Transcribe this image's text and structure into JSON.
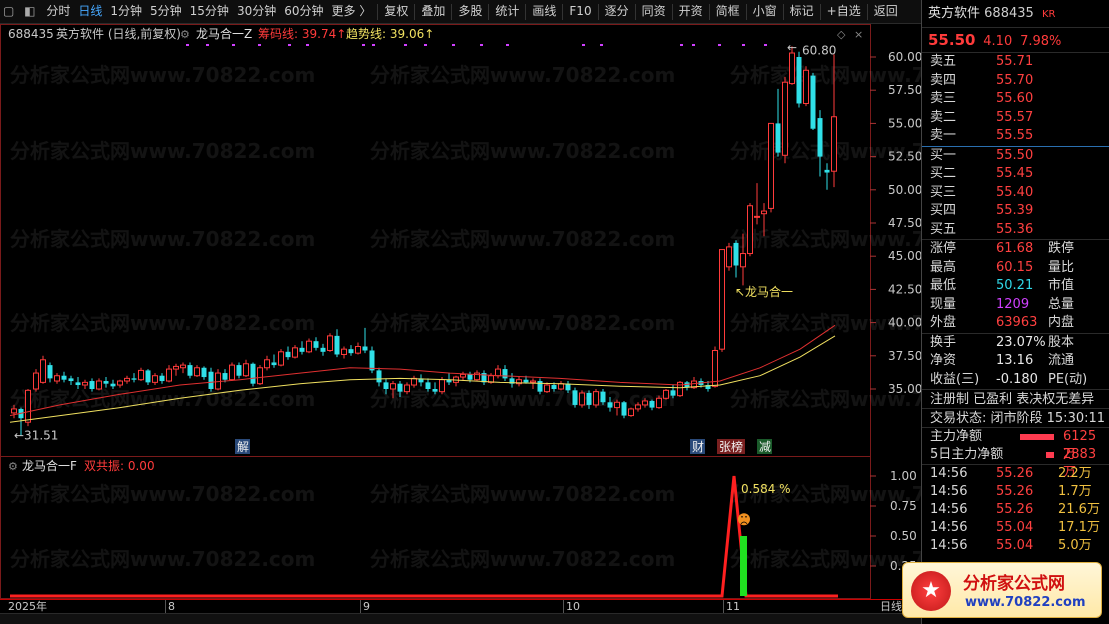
{
  "toolbar": {
    "items": [
      "分时",
      "日线",
      "1分钟",
      "5分钟",
      "15分钟",
      "30分钟",
      "60分钟",
      "更多 〉",
      "复权",
      "叠加",
      "多股",
      "统计",
      "画线",
      "F10",
      "逐分",
      "同资",
      "开资",
      "简框",
      "小窗",
      "标记",
      "+自选",
      "返回"
    ],
    "active": "日线"
  },
  "chart": {
    "header_code": "688435",
    "header_name": "英方软件 (日线,前复权)",
    "indicator_name": "龙马合一Z",
    "chip_label": "筹码线: 39.74↑",
    "trend_label": "趋势线: 39.06↑",
    "high_label": "60.80",
    "low_label": "31.51",
    "signal_label": "龙马合一",
    "markers": [
      "解",
      "财",
      "张榜",
      "减"
    ],
    "y_ticks": [
      "60.00",
      "57.50",
      "55.00",
      "52.50",
      "50.00",
      "47.50",
      "45.00",
      "42.50",
      "40.00",
      "37.50",
      "35.00"
    ],
    "lower_title": "龙马合一F",
    "lower_value": "双共振: 0.00",
    "lower_ticks": [
      "1.00",
      "0.75",
      "0.50",
      "0.25"
    ],
    "pct_label": "0.584 %",
    "x_labels": [
      "2025年",
      "8",
      "9",
      "10",
      "11",
      "日线"
    ],
    "watermark": "分析家公式网www.70822.com",
    "colors": {
      "up": "#ff3b3b",
      "down": "#30e0e8",
      "ma1": "#e03030",
      "ma2": "#f0e060",
      "signal": "#ff2020",
      "bar": "#20e020"
    }
  },
  "quote": {
    "name": "英方软件",
    "code": "688435",
    "tag": "KR",
    "price": "55.50",
    "change": "4.10",
    "pct": "7.98%",
    "asks": [
      {
        "label": "卖五",
        "price": "55.71"
      },
      {
        "label": "卖四",
        "price": "55.70"
      },
      {
        "label": "卖三",
        "price": "55.60"
      },
      {
        "label": "卖二",
        "price": "55.57"
      },
      {
        "label": "卖一",
        "price": "55.55"
      }
    ],
    "bids": [
      {
        "label": "买一",
        "price": "55.50"
      },
      {
        "label": "买二",
        "price": "55.45"
      },
      {
        "label": "买三",
        "price": "55.40"
      },
      {
        "label": "买四",
        "price": "55.39"
      },
      {
        "label": "买五",
        "price": "55.36"
      }
    ],
    "stats": [
      {
        "l": "涨停",
        "v": "61.68",
        "l2": "跌停"
      },
      {
        "l": "最高",
        "v": "60.15",
        "l2": "量比"
      },
      {
        "l": "最低",
        "v": "50.21",
        "l2": "市值"
      },
      {
        "l": "现量",
        "v": "1209",
        "l2": "总量"
      },
      {
        "l": "外盘",
        "v": "63963",
        "l2": "内盘"
      }
    ],
    "stats2": [
      {
        "l": "换手",
        "v": "23.07%",
        "l2": "股本"
      },
      {
        "l": "净资",
        "v": "13.16",
        "l2": "流通"
      },
      {
        "l": "收益(三)",
        "v": "-0.180",
        "l2": "PE(动)"
      }
    ],
    "reg_line": "注册制 已盈利 表决权无差异",
    "status_line": "交易状态: 闭市阶段 15:30:11",
    "flows": [
      {
        "n": "主力净额",
        "amt": "6125万",
        "w": 34
      },
      {
        "n": "5日主力净额",
        "amt": "2883万",
        "w": 8
      }
    ],
    "ticks": [
      {
        "t": "14:56",
        "p": "55.26",
        "v": "2.2万"
      },
      {
        "t": "14:56",
        "p": "55.26",
        "v": "1.7万"
      },
      {
        "t": "14:56",
        "p": "55.26",
        "v": "21.6万"
      },
      {
        "t": "14:56",
        "p": "55.04",
        "v": "17.1万"
      },
      {
        "t": "14:56",
        "p": "55.04",
        "v": "5.0万"
      }
    ]
  },
  "logo": {
    "title": "分析家公式网",
    "url": "www.70822.com"
  }
}
